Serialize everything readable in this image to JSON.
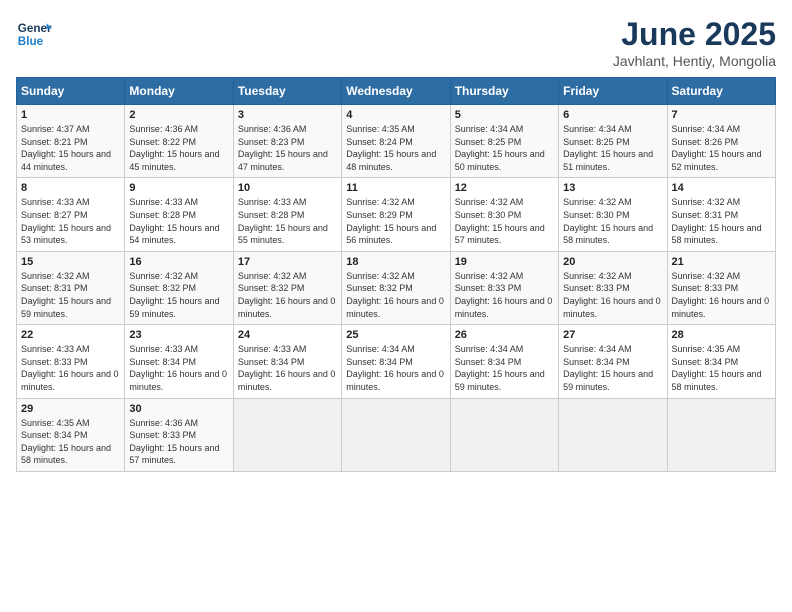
{
  "logo": {
    "line1": "General",
    "line2": "Blue"
  },
  "title": "June 2025",
  "subtitle": "Javhlant, Hentiy, Mongolia",
  "days_of_week": [
    "Sunday",
    "Monday",
    "Tuesday",
    "Wednesday",
    "Thursday",
    "Friday",
    "Saturday"
  ],
  "weeks": [
    [
      {
        "day": "1",
        "sunrise": "4:37 AM",
        "sunset": "8:21 PM",
        "daylight": "15 hours and 44 minutes."
      },
      {
        "day": "2",
        "sunrise": "4:36 AM",
        "sunset": "8:22 PM",
        "daylight": "15 hours and 45 minutes."
      },
      {
        "day": "3",
        "sunrise": "4:36 AM",
        "sunset": "8:23 PM",
        "daylight": "15 hours and 47 minutes."
      },
      {
        "day": "4",
        "sunrise": "4:35 AM",
        "sunset": "8:24 PM",
        "daylight": "15 hours and 48 minutes."
      },
      {
        "day": "5",
        "sunrise": "4:34 AM",
        "sunset": "8:25 PM",
        "daylight": "15 hours and 50 minutes."
      },
      {
        "day": "6",
        "sunrise": "4:34 AM",
        "sunset": "8:25 PM",
        "daylight": "15 hours and 51 minutes."
      },
      {
        "day": "7",
        "sunrise": "4:34 AM",
        "sunset": "8:26 PM",
        "daylight": "15 hours and 52 minutes."
      }
    ],
    [
      {
        "day": "8",
        "sunrise": "4:33 AM",
        "sunset": "8:27 PM",
        "daylight": "15 hours and 53 minutes."
      },
      {
        "day": "9",
        "sunrise": "4:33 AM",
        "sunset": "8:28 PM",
        "daylight": "15 hours and 54 minutes."
      },
      {
        "day": "10",
        "sunrise": "4:33 AM",
        "sunset": "8:28 PM",
        "daylight": "15 hours and 55 minutes."
      },
      {
        "day": "11",
        "sunrise": "4:32 AM",
        "sunset": "8:29 PM",
        "daylight": "15 hours and 56 minutes."
      },
      {
        "day": "12",
        "sunrise": "4:32 AM",
        "sunset": "8:30 PM",
        "daylight": "15 hours and 57 minutes."
      },
      {
        "day": "13",
        "sunrise": "4:32 AM",
        "sunset": "8:30 PM",
        "daylight": "15 hours and 58 minutes."
      },
      {
        "day": "14",
        "sunrise": "4:32 AM",
        "sunset": "8:31 PM",
        "daylight": "15 hours and 58 minutes."
      }
    ],
    [
      {
        "day": "15",
        "sunrise": "4:32 AM",
        "sunset": "8:31 PM",
        "daylight": "15 hours and 59 minutes."
      },
      {
        "day": "16",
        "sunrise": "4:32 AM",
        "sunset": "8:32 PM",
        "daylight": "15 hours and 59 minutes."
      },
      {
        "day": "17",
        "sunrise": "4:32 AM",
        "sunset": "8:32 PM",
        "daylight": "16 hours and 0 minutes."
      },
      {
        "day": "18",
        "sunrise": "4:32 AM",
        "sunset": "8:32 PM",
        "daylight": "16 hours and 0 minutes."
      },
      {
        "day": "19",
        "sunrise": "4:32 AM",
        "sunset": "8:33 PM",
        "daylight": "16 hours and 0 minutes."
      },
      {
        "day": "20",
        "sunrise": "4:32 AM",
        "sunset": "8:33 PM",
        "daylight": "16 hours and 0 minutes."
      },
      {
        "day": "21",
        "sunrise": "4:32 AM",
        "sunset": "8:33 PM",
        "daylight": "16 hours and 0 minutes."
      }
    ],
    [
      {
        "day": "22",
        "sunrise": "4:33 AM",
        "sunset": "8:33 PM",
        "daylight": "16 hours and 0 minutes."
      },
      {
        "day": "23",
        "sunrise": "4:33 AM",
        "sunset": "8:34 PM",
        "daylight": "16 hours and 0 minutes."
      },
      {
        "day": "24",
        "sunrise": "4:33 AM",
        "sunset": "8:34 PM",
        "daylight": "16 hours and 0 minutes."
      },
      {
        "day": "25",
        "sunrise": "4:34 AM",
        "sunset": "8:34 PM",
        "daylight": "16 hours and 0 minutes."
      },
      {
        "day": "26",
        "sunrise": "4:34 AM",
        "sunset": "8:34 PM",
        "daylight": "15 hours and 59 minutes."
      },
      {
        "day": "27",
        "sunrise": "4:34 AM",
        "sunset": "8:34 PM",
        "daylight": "15 hours and 59 minutes."
      },
      {
        "day": "28",
        "sunrise": "4:35 AM",
        "sunset": "8:34 PM",
        "daylight": "15 hours and 58 minutes."
      }
    ],
    [
      {
        "day": "29",
        "sunrise": "4:35 AM",
        "sunset": "8:34 PM",
        "daylight": "15 hours and 58 minutes."
      },
      {
        "day": "30",
        "sunrise": "4:36 AM",
        "sunset": "8:33 PM",
        "daylight": "15 hours and 57 minutes."
      },
      null,
      null,
      null,
      null,
      null
    ]
  ]
}
